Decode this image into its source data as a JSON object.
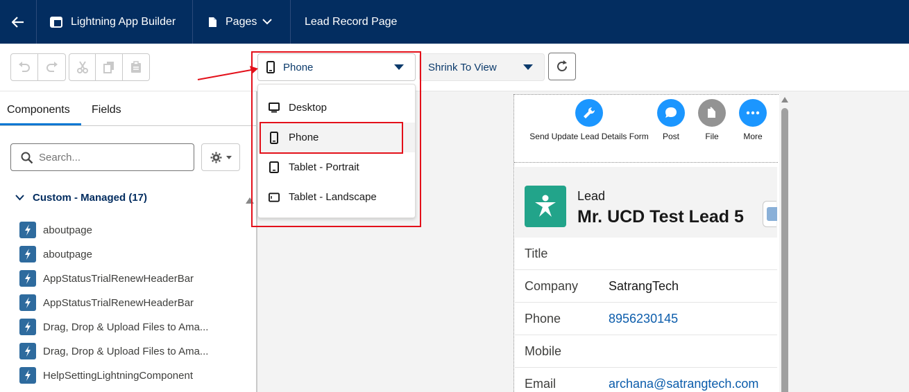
{
  "topbar": {
    "app_name": "Lightning App Builder",
    "pages_label": "Pages",
    "page_title": "Lead Record Page"
  },
  "toolbar": {
    "device_selected": "Phone",
    "zoom_selected": "Shrink To View"
  },
  "device_menu": {
    "items": [
      {
        "label": "Desktop",
        "icon": "desktop-icon"
      },
      {
        "label": "Phone",
        "icon": "phone-icon",
        "selected": true
      },
      {
        "label": "Tablet - Portrait",
        "icon": "tablet-portrait-icon"
      },
      {
        "label": "Tablet - Landscape",
        "icon": "tablet-landscape-icon"
      }
    ]
  },
  "left_panel": {
    "tabs": [
      "Components",
      "Fields"
    ],
    "search_placeholder": "Search...",
    "section_title": "Custom - Managed (17)",
    "components": [
      "aboutpage",
      "aboutpage",
      "AppStatusTrialRenewHeaderBar",
      "AppStatusTrialRenewHeaderBar",
      "Drag, Drop & Upload Files to Ama...",
      "Drag, Drop & Upload Files to Ama...",
      "HelpSettingLightningComponent"
    ]
  },
  "preview": {
    "actions": [
      {
        "label": "Send Update Lead Details Form",
        "icon": "wrench-icon",
        "color": "#1b96ff"
      },
      {
        "label": "Post",
        "icon": "chat-icon",
        "color": "#1b96ff"
      },
      {
        "label": "File",
        "icon": "file-icon",
        "color": "#939393"
      },
      {
        "label": "More",
        "icon": "more-icon",
        "color": "#1b96ff"
      }
    ],
    "record_type": "Lead",
    "record_name": "Mr. UCD Test Lead 5",
    "fields": [
      {
        "label": "Title",
        "value": ""
      },
      {
        "label": "Company",
        "value": "SatrangTech"
      },
      {
        "label": "Phone",
        "value": "8956230145"
      },
      {
        "label": "Mobile",
        "value": ""
      },
      {
        "label": "Email",
        "value": "archana@satrangtech.com"
      }
    ]
  },
  "colors": {
    "header_bg": "#032d60",
    "annotation_red": "#e3101a",
    "lead_icon_bg": "#22a48a",
    "link": "#0b5cab"
  }
}
